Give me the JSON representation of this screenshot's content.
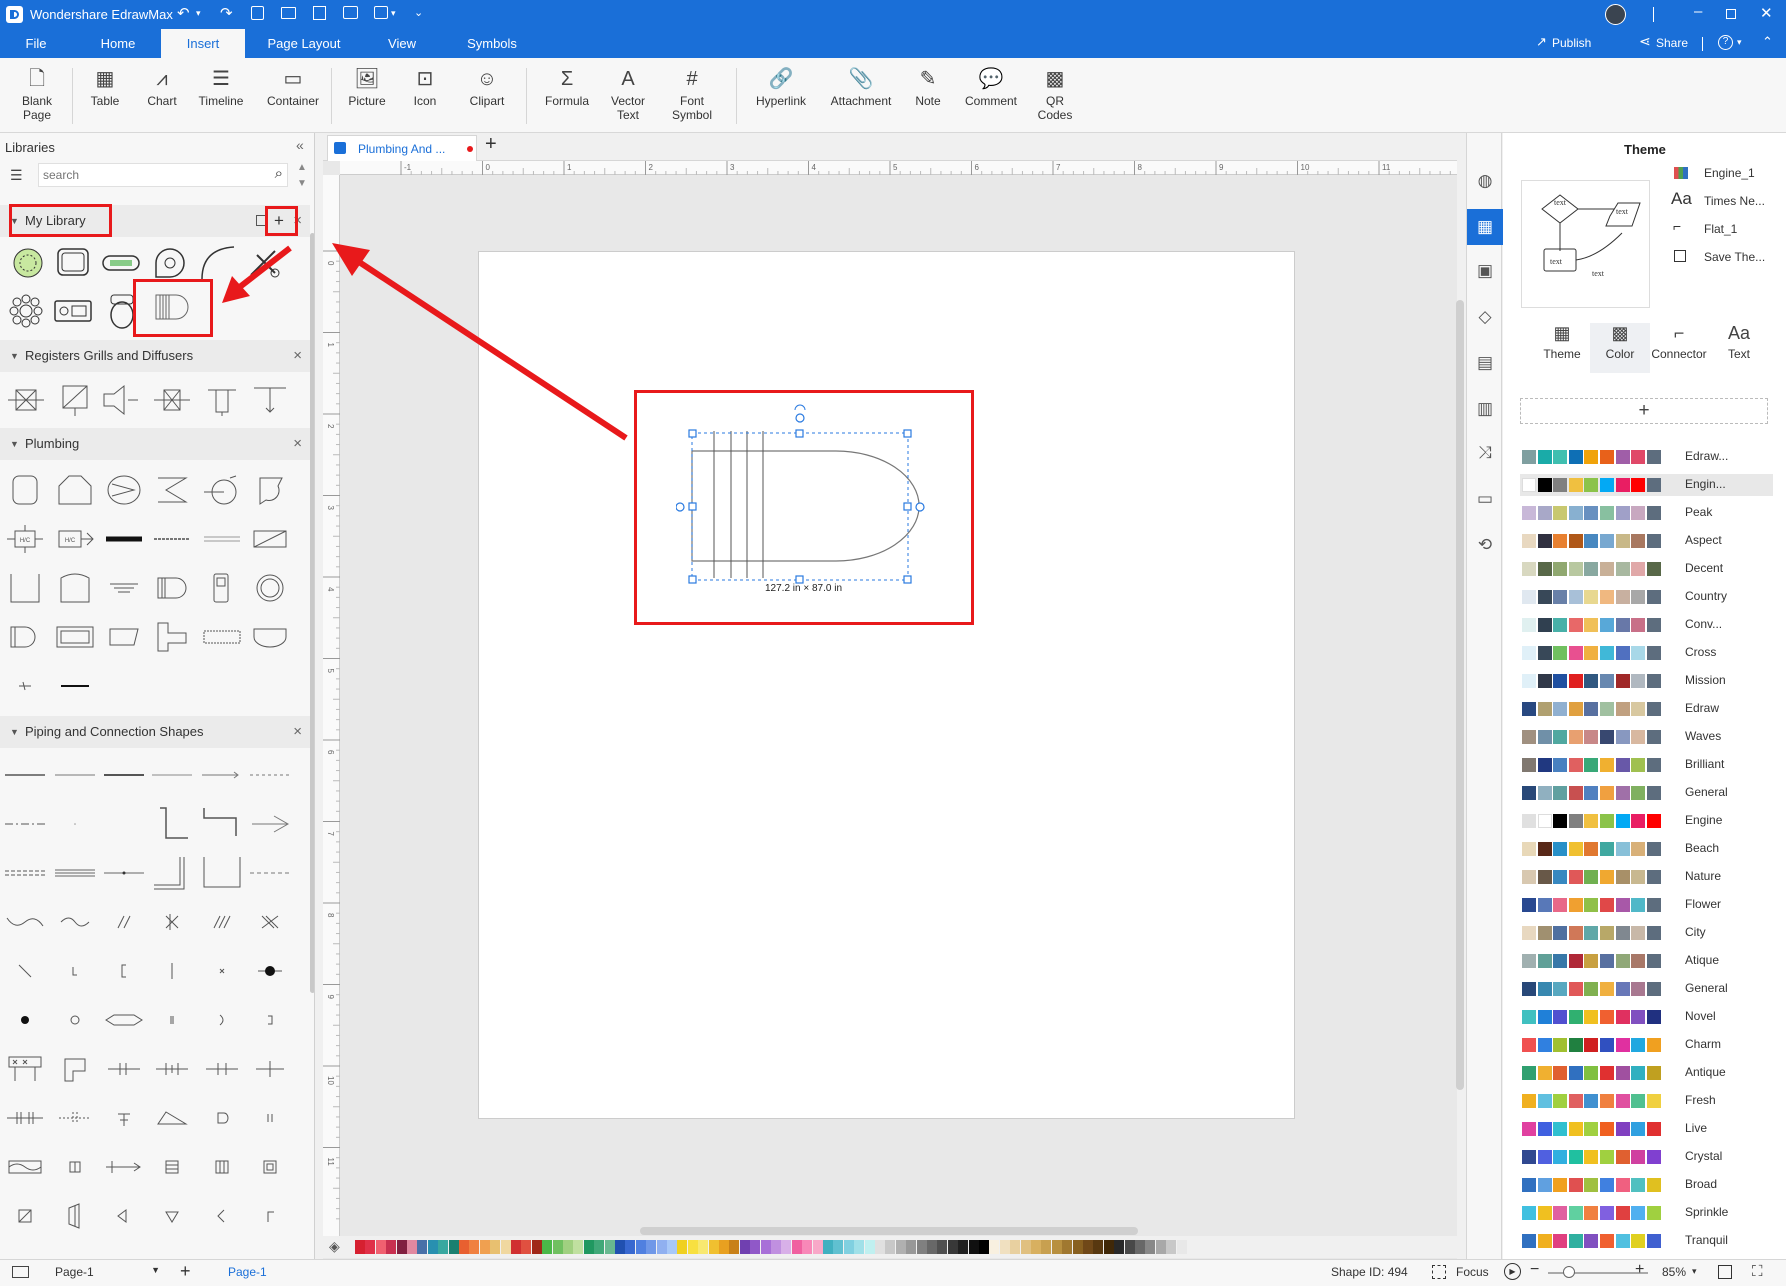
{
  "app": {
    "title": "Wondershare EdrawMax"
  },
  "menu": {
    "tabs": [
      "File",
      "Home",
      "Insert",
      "Page Layout",
      "View",
      "Symbols"
    ],
    "active": "Insert",
    "publish": "Publish",
    "share": "Share"
  },
  "ribbon": {
    "blank_page": "Blank Page",
    "table": "Table",
    "chart": "Chart",
    "timeline": "Timeline",
    "container": "Container",
    "picture": "Picture",
    "icon": "Icon",
    "clipart": "Clipart",
    "formula": "Formula",
    "vector_text": "Vector Text",
    "font_symbol": "Font Symbol",
    "hyperlink": "Hyperlink",
    "attachment": "Attachment",
    "note": "Note",
    "comment": "Comment",
    "qr_codes": "QR Codes"
  },
  "libraries": {
    "title": "Libraries",
    "search_placeholder": "search",
    "sections": {
      "my_library": "My Library",
      "registers": "Registers Grills and Diffusers",
      "plumbing": "Plumbing",
      "piping": "Piping and Connection Shapes"
    }
  },
  "document": {
    "tab_title": "Plumbing And ...",
    "shape_size_label": "127.2 in × 87.0 in",
    "ruler_top": [
      "-1",
      "0",
      "1",
      "2",
      "3",
      "4",
      "5",
      "6",
      "7",
      "8",
      "9",
      "10",
      "11"
    ],
    "ruler_left": [
      "0",
      "1",
      "2",
      "3",
      "4",
      "5",
      "6",
      "7",
      "8",
      "9",
      "10",
      "11"
    ]
  },
  "theme_panel": {
    "title": "Theme",
    "preview_labels": [
      "text",
      "text",
      "text",
      "text"
    ],
    "options": [
      "Engine_1",
      "Times Ne...",
      "Flat_1",
      "Save The..."
    ],
    "tabs": [
      "Theme",
      "Color",
      "Connector",
      "Text"
    ],
    "active_tab": "Color",
    "palettes": [
      {
        "name": "Edraw...",
        "colors": [
          "#7f9fa0",
          "#1aaba8",
          "#3fbfb0",
          "#0e6fb5",
          "#f0a30a",
          "#e8611a",
          "#a05ea8",
          "#e04868",
          "#5d6d7e"
        ]
      },
      {
        "name": "Engin...",
        "colors": [
          "#ffffff",
          "#000000",
          "#808080",
          "#f0c040",
          "#8bc34a",
          "#03a9f4",
          "#e91e63",
          "#ff0000",
          "#5d6d7e"
        ]
      },
      {
        "name": "Peak",
        "colors": [
          "#c8b8d8",
          "#a8a8c8",
          "#c8c870",
          "#88b0d0",
          "#6890c0",
          "#88c0a0",
          "#a0a0c8",
          "#c8a8c0",
          "#5d6d7e"
        ]
      },
      {
        "name": "Aspect",
        "colors": [
          "#e8d8c0",
          "#303040",
          "#e88030",
          "#b05818",
          "#4888c0",
          "#78a8d0",
          "#c8b888",
          "#a87860",
          "#5d6d7e"
        ]
      },
      {
        "name": "Decent",
        "colors": [
          "#d8d8c0",
          "#586848",
          "#90a870",
          "#b8c8a0",
          "#88a8a0",
          "#c8b098",
          "#a8b8a0",
          "#e0a8a8",
          "#586848"
        ]
      },
      {
        "name": "Country",
        "colors": [
          "#e0e8f0",
          "#384858",
          "#6880a8",
          "#a8c0d8",
          "#e8d890",
          "#f0b880",
          "#c8b0a0",
          "#a8a8a8",
          "#5d6d7e"
        ]
      },
      {
        "name": "Conv...",
        "colors": [
          "#e0f0f0",
          "#304050",
          "#48b0a8",
          "#e86868",
          "#f0c058",
          "#58a8d8",
          "#6878a8",
          "#c87088",
          "#5d6d7e"
        ]
      },
      {
        "name": "Cross",
        "colors": [
          "#e0f0f8",
          "#384858",
          "#70c060",
          "#e85090",
          "#f0b040",
          "#40b8d8",
          "#5070c0",
          "#a8d8e8",
          "#5d6d7e"
        ]
      },
      {
        "name": "Mission",
        "colors": [
          "#e0f0f8",
          "#303848",
          "#2050a0",
          "#e02020",
          "#305880",
          "#6888b0",
          "#a02828",
          "#b0b8c0",
          "#5d6d7e"
        ]
      },
      {
        "name": "Edraw",
        "colors": [
          "#284880",
          "#b0a070",
          "#90b0d0",
          "#e0a040",
          "#5870a0",
          "#a0c0a0",
          "#c0a080",
          "#d8c8a0",
          "#5d6d7e"
        ]
      },
      {
        "name": "Waves",
        "colors": [
          "#a09080",
          "#7090a8",
          "#50a8a0",
          "#e8a070",
          "#c88888",
          "#384870",
          "#8898c0",
          "#d8b8a0",
          "#5d6d7e"
        ]
      },
      {
        "name": "Brilliant",
        "colors": [
          "#807870",
          "#203880",
          "#4880c0",
          "#e06060",
          "#38a878",
          "#f0b030",
          "#6858a8",
          "#a0c050",
          "#5d6d7e"
        ]
      },
      {
        "name": "General",
        "colors": [
          "#284878",
          "#90b0c0",
          "#60a0a0",
          "#c85050",
          "#5080c0",
          "#f0a040",
          "#a070a8",
          "#80b060",
          "#5d6d7e"
        ]
      },
      {
        "name": "Engine",
        "colors": [
          "#e0e0e0",
          "#ffffff",
          "#000000",
          "#808080",
          "#f0c040",
          "#8bc34a",
          "#03a9f4",
          "#e91e63",
          "#ff0000"
        ]
      },
      {
        "name": "Beach",
        "colors": [
          "#e8d8b8",
          "#582818",
          "#2890c8",
          "#f0c030",
          "#e07830",
          "#40a8a0",
          "#88c0d8",
          "#d8b078",
          "#5d6d7e"
        ]
      },
      {
        "name": "Nature",
        "colors": [
          "#d8c8b0",
          "#685848",
          "#3888c0",
          "#e05858",
          "#70b050",
          "#f0a830",
          "#a89068",
          "#c8b890",
          "#5d6d7e"
        ]
      },
      {
        "name": "Flower",
        "colors": [
          "#284890",
          "#5878b8",
          "#e86888",
          "#f0a030",
          "#90c048",
          "#e04848",
          "#a858a8",
          "#50b8c8",
          "#5d6d7e"
        ]
      },
      {
        "name": "City",
        "colors": [
          "#e8d8c0",
          "#a09070",
          "#5070a0",
          "#d07858",
          "#60a8a8",
          "#b8a868",
          "#808890",
          "#c8b8a8",
          "#5d6d7e"
        ]
      },
      {
        "name": "Atique",
        "colors": [
          "#a0b0b0",
          "#60a098",
          "#3878a8",
          "#b02838",
          "#c8a040",
          "#5870a0",
          "#90a878",
          "#a87868",
          "#5d6d7e"
        ]
      },
      {
        "name": "General",
        "colors": [
          "#284878",
          "#3888b0",
          "#58a8c0",
          "#e05858",
          "#80b050",
          "#f0b040",
          "#6878b8",
          "#a87890",
          "#5d6d7e"
        ]
      },
      {
        "name": "Novel",
        "colors": [
          "#40c0c0",
          "#2080d8",
          "#5050d0",
          "#30b070",
          "#f0c020",
          "#f06030",
          "#e03060",
          "#8050c0",
          "#203080"
        ]
      },
      {
        "name": "Charm",
        "colors": [
          "#f05050",
          "#3080e0",
          "#a0c030",
          "#208040",
          "#d02020",
          "#3050c0",
          "#e030a0",
          "#20a8e0",
          "#f0a020"
        ]
      },
      {
        "name": "Antique",
        "colors": [
          "#30a070",
          "#f0b030",
          "#e06030",
          "#3070c0",
          "#80c040",
          "#e03030",
          "#a050a0",
          "#30b0c0",
          "#c0a020"
        ]
      },
      {
        "name": "Fresh",
        "colors": [
          "#f0b020",
          "#60c0e0",
          "#a0d040",
          "#e06060",
          "#4090d0",
          "#f08040",
          "#e050a0",
          "#50c090",
          "#f0d040"
        ]
      },
      {
        "name": "Live",
        "colors": [
          "#e040a0",
          "#4060e0",
          "#30c0d0",
          "#f0c020",
          "#a0d040",
          "#f06020",
          "#8040c0",
          "#30a0e0",
          "#e03030"
        ]
      },
      {
        "name": "Crystal",
        "colors": [
          "#304890",
          "#5060e0",
          "#30b0e0",
          "#20c0a0",
          "#f0c020",
          "#a0d040",
          "#e06030",
          "#d040a0",
          "#8040d0"
        ]
      },
      {
        "name": "Broad",
        "colors": [
          "#3070c0",
          "#60a0e0",
          "#f0a020",
          "#e05050",
          "#a0c040",
          "#4080e0",
          "#f06080",
          "#50c0c0",
          "#e0c020"
        ]
      },
      {
        "name": "Sprinkle",
        "colors": [
          "#40c0e0",
          "#f0c020",
          "#e060a0",
          "#60d0a0",
          "#f08040",
          "#8060e0",
          "#e04040",
          "#50b0f0",
          "#a0d040"
        ]
      },
      {
        "name": "Tranquil",
        "colors": [
          "#3070c0",
          "#f0b020",
          "#e04080",
          "#30b0a0",
          "#8050c0",
          "#f06030",
          "#50c0e0",
          "#e0d020",
          "#4060d0"
        ]
      }
    ]
  },
  "status": {
    "page_selector": "Page-1",
    "page_tab": "Page-1",
    "shape_id": "Shape ID: 494",
    "focus": "Focus",
    "zoom": "85%"
  },
  "color_strip": [
    "#d62030",
    "#e03048",
    "#f06070",
    "#c83050",
    "#802040",
    "#e088a0",
    "#4870a8",
    "#2890b0",
    "#38a8a0",
    "#1a8070",
    "#e86030",
    "#f08040",
    "#f0a050",
    "#e8c070",
    "#f0d8a0",
    "#d03030",
    "#e05040",
    "#a02818",
    "#4ab848",
    "#70c060",
    "#a0d080",
    "#c0e0a0",
    "#209860",
    "#40a878",
    "#68b890",
    "#2050b0",
    "#3868d0",
    "#5080e0",
    "#7098e8",
    "#90b0f0",
    "#a8c8f8",
    "#f0d020",
    "#f8e040",
    "#f8e870",
    "#f0c030",
    "#e8a020",
    "#c88018",
    "#7040b0",
    "#9058c8",
    "#a870d8",
    "#c090e0",
    "#d8b0e8",
    "#f060a0",
    "#f888b8",
    "#f8a8c8",
    "#40b0c0",
    "#60c0d0",
    "#80d0e0",
    "#a0e0e8",
    "#c0f0f0",
    "#e0e0e0",
    "#c8c8c8",
    "#b0b0b0",
    "#989898",
    "#808080",
    "#686868",
    "#505050",
    "#383838",
    "#202020",
    "#101010",
    "#000000",
    "#f8f0e0",
    "#f0e0c0",
    "#e8d0a0",
    "#e0c080",
    "#d8b060",
    "#c8a050",
    "#b89040",
    "#a07830",
    "#886020",
    "#704818",
    "#583810",
    "#402808",
    "#282828",
    "#484848",
    "#686868",
    "#888888",
    "#a8a8a8",
    "#c8c8c8",
    "#e8e8e8"
  ]
}
